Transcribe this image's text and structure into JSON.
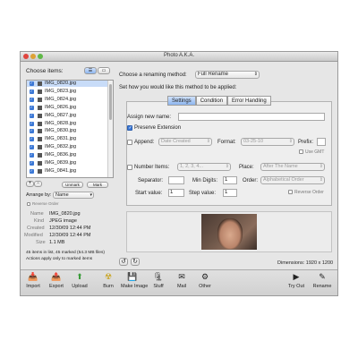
{
  "app": {
    "title": "Photo A.K.A."
  },
  "left": {
    "choose_items": "Choose items:",
    "files": [
      "IMG_0820.jpg",
      "IMG_0823.jpg",
      "IMG_0824.jpg",
      "IMG_0826.jpg",
      "IMG_0827.jpg",
      "IMG_0828.jpg",
      "IMG_0830.jpg",
      "IMG_0831.jpg",
      "IMG_0832.jpg",
      "IMG_0836.jpg",
      "IMG_0839.jpg",
      "IMG_0841.jpg"
    ],
    "plus": "+",
    "minus": "−",
    "unmark": "Unmark",
    "mark": "Mark",
    "arrange_by_label": "Arrange by:",
    "arrange_by_value": "Name",
    "reverse_order": "Reverse Order",
    "info": {
      "name_label": "Name",
      "name": "IMG_0820.jpg",
      "kind_label": "Kind",
      "kind": "JPEG image",
      "created_label": "Created",
      "created": "12/30/09 12:44 PM",
      "modified_label": "Modified",
      "modified": "12/30/09 12:44 PM",
      "size_label": "Size",
      "size": "1.1 MB"
    },
    "status1": "45 items in list, 45 marked (54.3 MB files)",
    "status2": "Actions apply only to marked items"
  },
  "right": {
    "method_label": "Choose a renaming method:",
    "method_value": "Full Rename",
    "applied_text": "Set how you would like this method to be applied:",
    "tabs": [
      "Settings",
      "Condition",
      "Error Handling"
    ],
    "assign_label": "Assign new name:",
    "assign_value": "",
    "preserve_ext": "Preserve Extension",
    "append": "Append:",
    "append_value": "Date Created",
    "format_label": "Format:",
    "format_value": "03-25-10",
    "prefix_label": "Prefix:",
    "use_gmt": "Use GMT",
    "number_items": "Number Items:",
    "number_value": "1, 2, 3, 4...",
    "place_label": "Place:",
    "place_value": "After The Name",
    "separator_label": "Separator:",
    "min_digits_label": "Min Digits:",
    "min_digits_value": "1",
    "order_label": "Order:",
    "order_value": "Alphabetical Order",
    "start_label": "Start value:",
    "start_value": "1",
    "step_label": "Step value:",
    "step_value": "1",
    "reverse_order": "Reverse Order",
    "dimensions": "Dimensions: 1920 x 1200"
  },
  "toolbar": {
    "import": "Import",
    "export": "Export",
    "upload": "Upload",
    "burn": "Burn",
    "make_image": "Make Image",
    "stuff": "Stuff",
    "mail": "Mail",
    "other": "Other",
    "try_out": "Try Out",
    "rename": "Rename"
  },
  "colors": {
    "accent": "#3b78d6",
    "selection": "#c8dcf8",
    "window": "#e6e6e6"
  }
}
